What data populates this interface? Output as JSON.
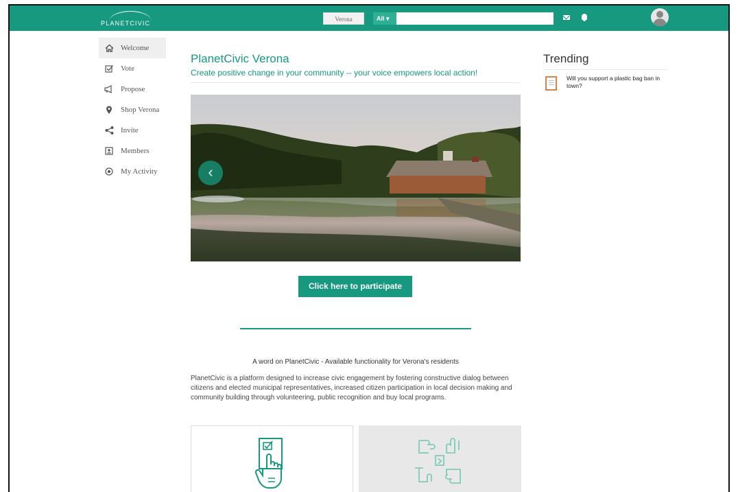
{
  "header": {
    "logo_text": "PLANETCIVIC",
    "location_label": "Verona",
    "search_scope": "All ▾",
    "search_placeholder": ""
  },
  "sidebar": {
    "items": [
      {
        "label": "Welcome",
        "icon": "home-icon",
        "active": true
      },
      {
        "label": "Vote",
        "icon": "checkbox-icon"
      },
      {
        "label": "Propose",
        "icon": "megaphone-icon"
      },
      {
        "label": "Shop Verona",
        "icon": "map-pin-icon"
      },
      {
        "label": "Invite",
        "icon": "share-icon"
      },
      {
        "label": "Members",
        "icon": "member-card-icon"
      },
      {
        "label": "My Activity",
        "icon": "activity-icon"
      }
    ]
  },
  "main": {
    "title": "PlanetCivic Verona",
    "subtitle": "Create positive change in your community -- your voice empowers local action!",
    "cta_label": "Click here to participate",
    "word_title": "A word on PlanetCivic - Available functionality for Verona's residents",
    "word_body": "PlanetCivic is a platform designed to increase civic engagement by fostering constructive dialog between citizens and elected municipal representatives, increased citizen participation in local decision making and community building through volunteering, public recognition and buy local programs."
  },
  "trending": {
    "title": "Trending",
    "items": [
      {
        "text": "Will you support a plastic bag ban in town?"
      }
    ]
  },
  "colors": {
    "brand_green": "#16997f",
    "trend_icon_orange": "#d98446"
  }
}
